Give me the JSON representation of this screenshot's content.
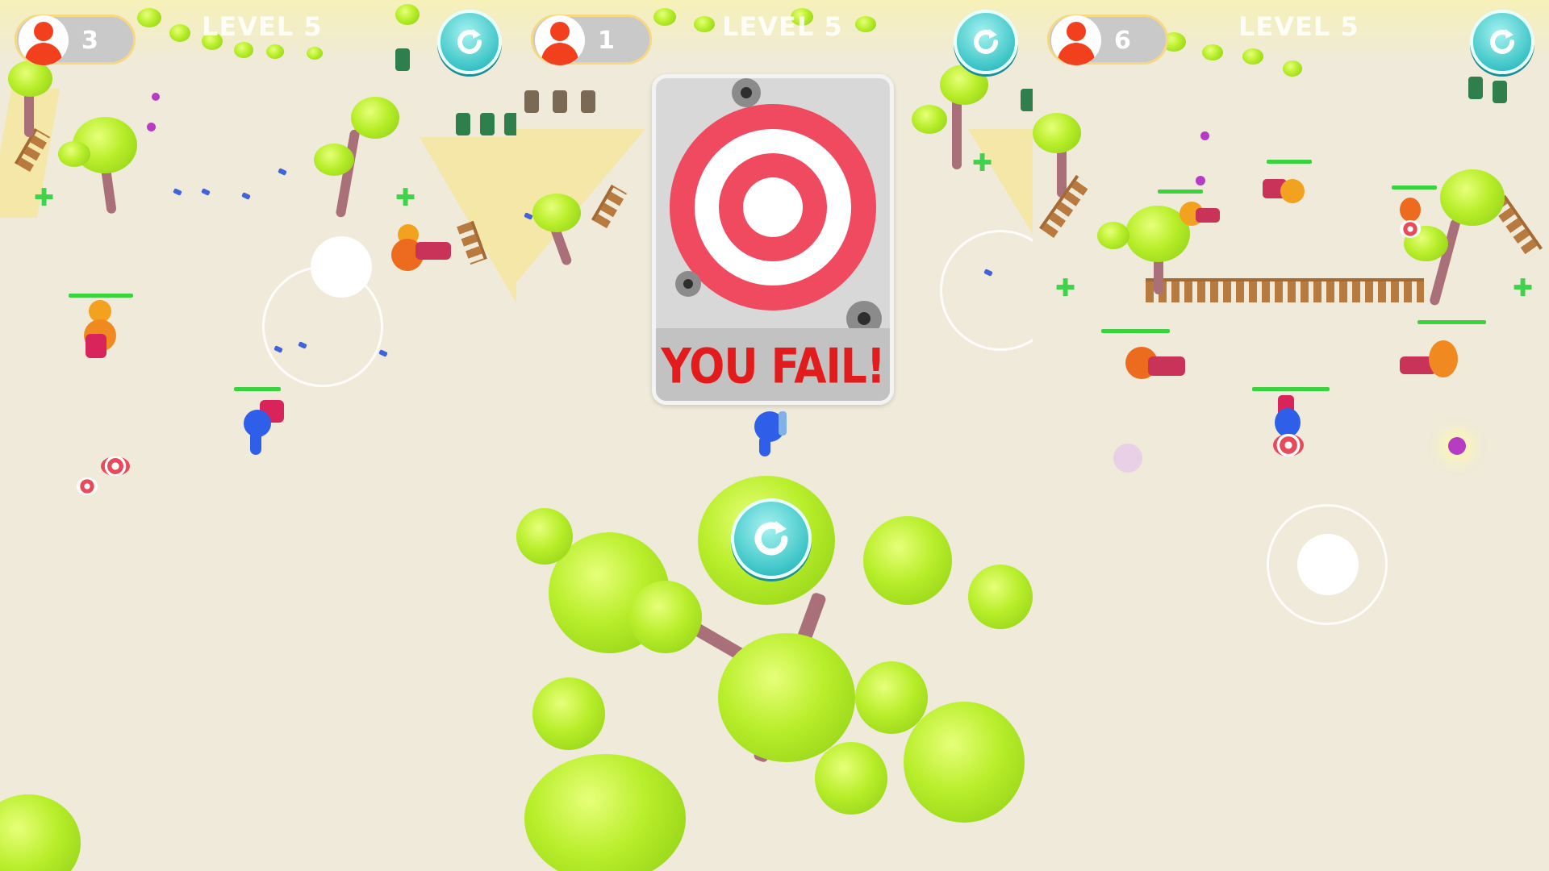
{
  "hud": {
    "panel1": {
      "alive_count": "3",
      "level_label": "LEVEL 5"
    },
    "panel2": {
      "alive_count": "1",
      "level_label": "LEVEL 5"
    },
    "panel3": {
      "alive_count": "6",
      "level_label": "LEVEL 5"
    }
  },
  "fail_popup": {
    "message": "YOU FAIL!"
  },
  "icons": {
    "restart": "restart-icon",
    "player": "player-avatar-icon",
    "target": "target-icon",
    "health": "health-cross-icon"
  },
  "colors": {
    "player": "#2f5ee8",
    "enemy": "#f08a20",
    "health_bar": "#39d33e",
    "fail_text": "#e21c1c",
    "restart_button": "#3cc4c6"
  }
}
